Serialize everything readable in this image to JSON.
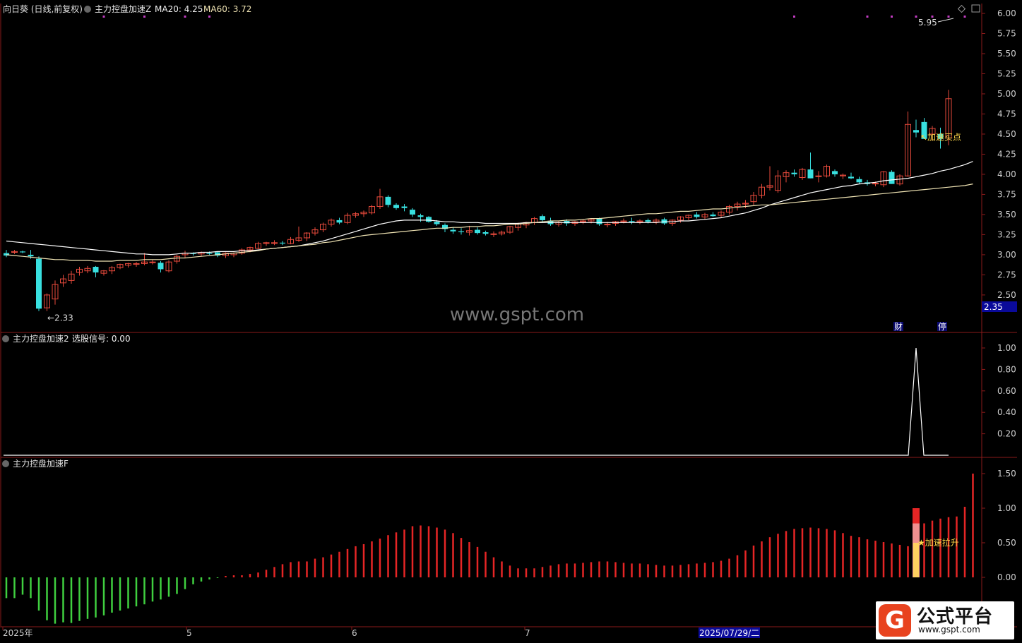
{
  "panel1": {
    "stock": "向日葵 (日线,前复权)",
    "indicator": "主力控盘加速Z",
    "ma20_label": "MA20: 4.25",
    "ma60_label": "MA60: 3.72",
    "high_label": "5.95",
    "low_label": "2.33",
    "buy_label": "加速买点",
    "current_price_label": "2.35",
    "tag_cai": "财",
    "tag_ting": "停"
  },
  "panel2": {
    "title": "主力控盘加速2",
    "signal_label": "选股信号: 0.00"
  },
  "panel3": {
    "title": "主力控盘加速F",
    "rise_label": "加速拉升"
  },
  "x_axis": {
    "labels": [
      "2025年",
      "5",
      "6",
      "7",
      "2025/07/29/二"
    ]
  },
  "watermark": "www.gspt.com",
  "logo": {
    "mark": "G",
    "name": "公式平台",
    "url": "www.gspt.com"
  },
  "colors": {
    "up": "#e84a3c",
    "down": "#38e0e0",
    "ma20": "#ffffff",
    "ma60": "#f0e4b4",
    "pos_bar": "#e62525",
    "neg_bar": "#3fcf3f",
    "accent_label": "#ffd84a"
  },
  "chart_data": [
    {
      "type": "candlestick",
      "title": "主力控盘加速Z",
      "y_ticks": [
        2.5,
        2.75,
        3.0,
        3.25,
        3.5,
        3.75,
        4.0,
        4.25,
        4.5,
        4.75,
        5.0,
        5.25,
        5.5,
        5.75,
        6.0
      ],
      "ylim": [
        2.35,
        6.0
      ],
      "ohlc": [
        [
          3.02,
          3.06,
          2.97,
          2.99
        ],
        [
          3.03,
          3.06,
          3.01,
          3.04
        ],
        [
          3.04,
          3.05,
          3.02,
          3.03
        ],
        [
          3.0,
          3.06,
          2.95,
          2.98
        ],
        [
          2.95,
          2.98,
          2.3,
          2.33
        ],
        [
          2.34,
          2.52,
          2.3,
          2.5
        ],
        [
          2.45,
          2.68,
          2.38,
          2.63
        ],
        [
          2.65,
          2.75,
          2.6,
          2.7
        ],
        [
          2.68,
          2.8,
          2.64,
          2.76
        ],
        [
          2.78,
          2.85,
          2.74,
          2.82
        ],
        [
          2.8,
          2.86,
          2.77,
          2.83
        ],
        [
          2.85,
          2.86,
          2.72,
          2.78
        ],
        [
          2.77,
          2.81,
          2.74,
          2.8
        ],
        [
          2.8,
          2.86,
          2.76,
          2.84
        ],
        [
          2.84,
          2.89,
          2.82,
          2.88
        ],
        [
          2.87,
          2.9,
          2.84,
          2.89
        ],
        [
          2.88,
          2.91,
          2.85,
          2.89
        ],
        [
          2.89,
          3.02,
          2.87,
          2.91
        ],
        [
          2.91,
          2.94,
          2.88,
          2.91
        ],
        [
          2.9,
          2.92,
          2.78,
          2.82
        ],
        [
          2.8,
          2.93,
          2.78,
          2.91
        ],
        [
          2.92,
          3.0,
          2.89,
          2.98
        ],
        [
          3.0,
          3.05,
          2.96,
          3.02
        ],
        [
          3.02,
          3.03,
          2.99,
          3.01
        ],
        [
          3.01,
          3.04,
          2.98,
          3.03
        ],
        [
          3.02,
          3.04,
          3.0,
          3.01
        ],
        [
          3.03,
          3.04,
          2.97,
          2.99
        ],
        [
          2.99,
          3.03,
          2.96,
          3.02
        ],
        [
          3.0,
          3.03,
          2.97,
          3.02
        ],
        [
          3.02,
          3.08,
          3.0,
          3.06
        ],
        [
          3.06,
          3.1,
          3.03,
          3.09
        ],
        [
          3.08,
          3.16,
          3.07,
          3.14
        ],
        [
          3.14,
          3.16,
          3.11,
          3.15
        ],
        [
          3.15,
          3.18,
          3.12,
          3.15
        ],
        [
          3.15,
          3.17,
          3.12,
          3.14
        ],
        [
          3.14,
          3.22,
          3.13,
          3.19
        ],
        [
          3.18,
          3.35,
          3.16,
          3.21
        ],
        [
          3.21,
          3.28,
          3.17,
          3.27
        ],
        [
          3.27,
          3.34,
          3.24,
          3.31
        ],
        [
          3.31,
          3.4,
          3.28,
          3.38
        ],
        [
          3.38,
          3.45,
          3.35,
          3.43
        ],
        [
          3.43,
          3.46,
          3.38,
          3.4
        ],
        [
          3.4,
          3.52,
          3.38,
          3.49
        ],
        [
          3.49,
          3.53,
          3.46,
          3.51
        ],
        [
          3.51,
          3.55,
          3.47,
          3.53
        ],
        [
          3.52,
          3.62,
          3.5,
          3.6
        ],
        [
          3.6,
          3.82,
          3.57,
          3.72
        ],
        [
          3.72,
          3.74,
          3.59,
          3.62
        ],
        [
          3.62,
          3.64,
          3.56,
          3.58
        ],
        [
          3.6,
          3.63,
          3.54,
          3.58
        ],
        [
          3.56,
          3.58,
          3.47,
          3.5
        ],
        [
          3.49,
          3.51,
          3.41,
          3.47
        ],
        [
          3.47,
          3.48,
          3.4,
          3.41
        ],
        [
          3.41,
          3.43,
          3.36,
          3.38
        ],
        [
          3.37,
          3.39,
          3.28,
          3.32
        ],
        [
          3.31,
          3.34,
          3.26,
          3.29
        ],
        [
          3.29,
          3.33,
          3.25,
          3.28
        ],
        [
          3.28,
          3.36,
          3.24,
          3.3
        ],
        [
          3.31,
          3.34,
          3.25,
          3.27
        ],
        [
          3.28,
          3.3,
          3.24,
          3.26
        ],
        [
          3.26,
          3.29,
          3.22,
          3.26
        ],
        [
          3.26,
          3.3,
          3.24,
          3.28
        ],
        [
          3.28,
          3.36,
          3.26,
          3.35
        ],
        [
          3.34,
          3.4,
          3.3,
          3.38
        ],
        [
          3.37,
          3.41,
          3.33,
          3.4
        ],
        [
          3.4,
          3.47,
          3.37,
          3.45
        ],
        [
          3.48,
          3.5,
          3.4,
          3.43
        ],
        [
          3.42,
          3.46,
          3.36,
          3.38
        ],
        [
          3.38,
          3.42,
          3.35,
          3.4
        ],
        [
          3.42,
          3.44,
          3.36,
          3.39
        ],
        [
          3.39,
          3.42,
          3.36,
          3.41
        ],
        [
          3.41,
          3.44,
          3.38,
          3.42
        ],
        [
          3.42,
          3.45,
          3.39,
          3.44
        ],
        [
          3.45,
          3.46,
          3.36,
          3.38
        ],
        [
          3.38,
          3.41,
          3.34,
          3.38
        ],
        [
          3.39,
          3.42,
          3.36,
          3.41
        ],
        [
          3.41,
          3.45,
          3.39,
          3.42
        ],
        [
          3.42,
          3.46,
          3.38,
          3.41
        ],
        [
          3.41,
          3.44,
          3.38,
          3.42
        ],
        [
          3.43,
          3.45,
          3.39,
          3.41
        ],
        [
          3.41,
          3.45,
          3.38,
          3.43
        ],
        [
          3.44,
          3.46,
          3.37,
          3.39
        ],
        [
          3.39,
          3.44,
          3.36,
          3.43
        ],
        [
          3.43,
          3.48,
          3.4,
          3.47
        ],
        [
          3.46,
          3.5,
          3.43,
          3.49
        ],
        [
          3.5,
          3.53,
          3.45,
          3.47
        ],
        [
          3.47,
          3.52,
          3.44,
          3.5
        ],
        [
          3.5,
          3.53,
          3.47,
          3.48
        ],
        [
          3.49,
          3.55,
          3.46,
          3.53
        ],
        [
          3.53,
          3.62,
          3.5,
          3.6
        ],
        [
          3.6,
          3.66,
          3.55,
          3.63
        ],
        [
          3.63,
          3.68,
          3.58,
          3.64
        ],
        [
          3.66,
          3.78,
          3.62,
          3.74
        ],
        [
          3.74,
          3.88,
          3.7,
          3.84
        ],
        [
          3.84,
          4.1,
          3.8,
          3.86
        ],
        [
          3.8,
          4.05,
          3.77,
          3.98
        ],
        [
          3.97,
          4.05,
          3.9,
          4.02
        ],
        [
          4.02,
          4.06,
          3.97,
          4.0
        ],
        [
          3.96,
          4.08,
          3.93,
          4.06
        ],
        [
          4.06,
          4.27,
          3.95,
          3.95
        ],
        [
          3.98,
          4.04,
          3.9,
          3.98
        ],
        [
          3.98,
          4.12,
          3.96,
          4.1
        ],
        [
          4.04,
          4.06,
          3.97,
          4.0
        ],
        [
          3.98,
          4.01,
          3.94,
          3.99
        ],
        [
          3.97,
          4.02,
          3.94,
          3.95
        ],
        [
          3.94,
          3.97,
          3.88,
          3.9
        ],
        [
          3.9,
          3.93,
          3.86,
          3.88
        ],
        [
          3.88,
          3.91,
          3.85,
          3.89
        ],
        [
          3.87,
          4.04,
          3.84,
          4.03
        ],
        [
          4.03,
          4.05,
          3.88,
          3.88
        ],
        [
          3.88,
          4.0,
          3.86,
          3.98
        ],
        [
          3.98,
          4.78,
          3.97,
          4.62
        ],
        [
          4.55,
          4.68,
          4.46,
          4.52
        ],
        [
          4.65,
          4.7,
          4.44,
          4.44
        ],
        [
          4.5,
          4.6,
          4.42,
          4.57
        ],
        [
          4.5,
          4.58,
          4.32,
          4.44
        ],
        [
          4.45,
          5.05,
          4.36,
          4.94
        ]
      ],
      "ma20": [
        3.17,
        3.16,
        3.15,
        3.14,
        3.13,
        3.12,
        3.11,
        3.1,
        3.09,
        3.08,
        3.07,
        3.06,
        3.05,
        3.04,
        3.03,
        3.02,
        3.01,
        3.01,
        3.0,
        3.0,
        3.0,
        3.01,
        3.02,
        3.02,
        3.03,
        3.03,
        3.04,
        3.04,
        3.04,
        3.05,
        3.05,
        3.06,
        3.07,
        3.08,
        3.09,
        3.1,
        3.11,
        3.13,
        3.15,
        3.17,
        3.2,
        3.23,
        3.26,
        3.29,
        3.32,
        3.35,
        3.38,
        3.4,
        3.42,
        3.43,
        3.43,
        3.43,
        3.43,
        3.42,
        3.41,
        3.41,
        3.4,
        3.4,
        3.4,
        3.39,
        3.39,
        3.39,
        3.39,
        3.39,
        3.4,
        3.4,
        3.4,
        3.4,
        3.4,
        3.4,
        3.4,
        3.4,
        3.4,
        3.4,
        3.4,
        3.4,
        3.4,
        3.4,
        3.4,
        3.4,
        3.4,
        3.41,
        3.41,
        3.42,
        3.42,
        3.43,
        3.44,
        3.45,
        3.46,
        3.48,
        3.5,
        3.52,
        3.55,
        3.58,
        3.62,
        3.65,
        3.68,
        3.71,
        3.74,
        3.77,
        3.79,
        3.81,
        3.83,
        3.85,
        3.86,
        3.88,
        3.89,
        3.9,
        3.92,
        3.93,
        3.94,
        3.95,
        3.97,
        3.99,
        4.01,
        4.04,
        4.06,
        4.09,
        4.12,
        4.16
      ],
      "ma60": [
        3.0,
        2.99,
        2.98,
        2.97,
        2.96,
        2.95,
        2.94,
        2.94,
        2.93,
        2.93,
        2.93,
        2.92,
        2.92,
        2.92,
        2.93,
        2.93,
        2.93,
        2.94,
        2.94,
        2.94,
        2.95,
        2.96,
        2.96,
        2.97,
        2.98,
        2.99,
        3.0,
        3.01,
        3.02,
        3.03,
        3.04,
        3.05,
        3.07,
        3.08,
        3.09,
        3.1,
        3.11,
        3.12,
        3.13,
        3.15,
        3.16,
        3.18,
        3.2,
        3.22,
        3.24,
        3.25,
        3.26,
        3.27,
        3.28,
        3.29,
        3.3,
        3.31,
        3.32,
        3.33,
        3.33,
        3.34,
        3.34,
        3.35,
        3.35,
        3.36,
        3.36,
        3.37,
        3.38,
        3.38,
        3.39,
        3.4,
        3.41,
        3.42,
        3.42,
        3.43,
        3.43,
        3.44,
        3.45,
        3.45,
        3.46,
        3.47,
        3.48,
        3.49,
        3.5,
        3.51,
        3.51,
        3.52,
        3.53,
        3.54,
        3.54,
        3.55,
        3.56,
        3.57,
        3.57,
        3.58,
        3.59,
        3.6,
        3.61,
        3.62,
        3.62,
        3.63,
        3.64,
        3.65,
        3.66,
        3.67,
        3.68,
        3.69,
        3.7,
        3.71,
        3.72,
        3.73,
        3.74,
        3.75,
        3.76,
        3.77,
        3.78,
        3.79,
        3.8,
        3.81,
        3.82,
        3.83,
        3.84,
        3.85,
        3.86,
        3.88
      ]
    },
    {
      "type": "line",
      "title": "主力控盘加速2",
      "series": [
        {
          "name": "选股信号",
          "spike_index": 112,
          "spike_value": 1.0,
          "baseline": 0.0
        }
      ],
      "y_ticks": [
        0.2,
        0.4,
        0.6,
        0.8,
        1.0
      ],
      "ylim": [
        0,
        1.1
      ]
    },
    {
      "type": "bar",
      "title": "主力控盘加速F",
      "y_ticks": [
        0.0,
        0.5,
        1.0,
        1.5
      ],
      "ylim": [
        -0.7,
        1.65
      ],
      "highlight_index": 112,
      "values": [
        -0.3,
        -0.3,
        -0.25,
        -0.3,
        -0.48,
        -0.62,
        -0.67,
        -0.65,
        -0.66,
        -0.63,
        -0.6,
        -0.58,
        -0.55,
        -0.51,
        -0.48,
        -0.45,
        -0.42,
        -0.39,
        -0.35,
        -0.32,
        -0.28,
        -0.24,
        -0.17,
        -0.1,
        -0.06,
        -0.03,
        -0.01,
        0.02,
        0.03,
        0.03,
        0.05,
        0.07,
        0.11,
        0.15,
        0.19,
        0.22,
        0.23,
        0.23,
        0.27,
        0.29,
        0.33,
        0.37,
        0.41,
        0.45,
        0.48,
        0.52,
        0.56,
        0.61,
        0.65,
        0.69,
        0.74,
        0.75,
        0.74,
        0.72,
        0.69,
        0.64,
        0.57,
        0.51,
        0.44,
        0.37,
        0.29,
        0.23,
        0.17,
        0.13,
        0.13,
        0.13,
        0.15,
        0.17,
        0.19,
        0.2,
        0.2,
        0.21,
        0.22,
        0.23,
        0.23,
        0.22,
        0.21,
        0.2,
        0.2,
        0.19,
        0.18,
        0.17,
        0.17,
        0.18,
        0.19,
        0.2,
        0.21,
        0.22,
        0.24,
        0.27,
        0.32,
        0.39,
        0.46,
        0.52,
        0.58,
        0.63,
        0.67,
        0.7,
        0.71,
        0.72,
        0.71,
        0.7,
        0.68,
        0.64,
        0.6,
        0.58,
        0.55,
        0.53,
        0.51,
        0.49,
        0.47,
        0.45,
        1.0,
        0.78,
        0.82,
        0.85,
        0.87,
        0.88,
        1.02,
        1.5
      ]
    }
  ]
}
